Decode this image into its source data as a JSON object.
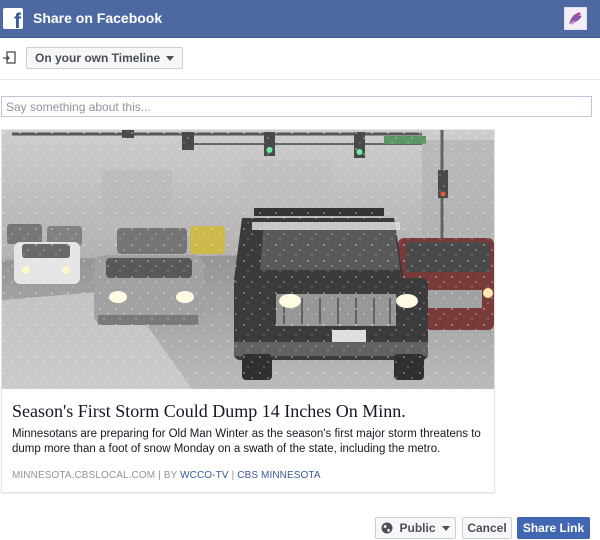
{
  "dialog": {
    "title": "Share on Facebook",
    "logo_letter": "f"
  },
  "privacy": {
    "target_label": "On your own Timeline"
  },
  "composer": {
    "placeholder": "Say something about this..."
  },
  "link_preview": {
    "title": "Season's First Storm Could Dump 14 Inches On Minn.",
    "description": "Minnesotans are preparing for Old Man Winter as the season's first major storm threatens to dump more than a foot of snow Monday on a swath of the state, including the metro.",
    "domain": "MINNESOTA.CBSLOCAL.COM",
    "by_label": "BY",
    "author": "WCCO-TV",
    "publisher": "CBS MINNESOTA"
  },
  "footer": {
    "audience_label": "Public",
    "cancel_label": "Cancel",
    "share_label": "Share Link"
  },
  "colors": {
    "header": "#4e69a2",
    "primary_button": "#4267b2",
    "link": "#3b5998"
  }
}
